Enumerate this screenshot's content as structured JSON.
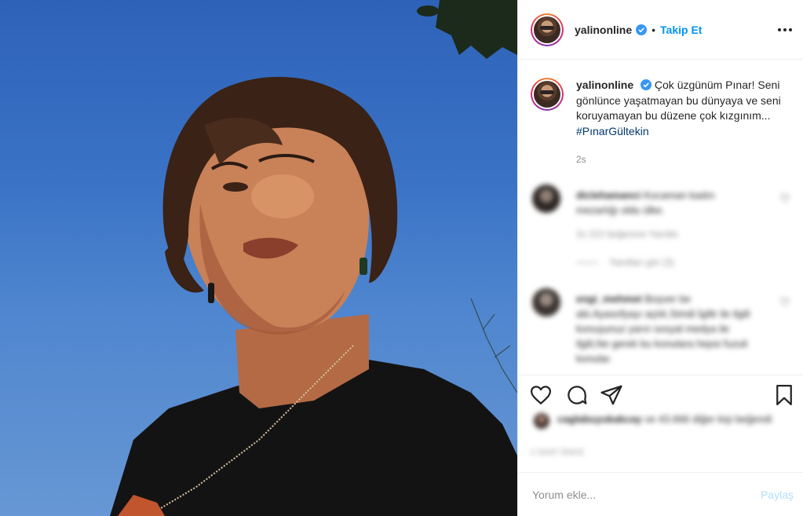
{
  "post": {
    "username": "yalinonline",
    "dot": "•",
    "follow_label": "Takip Et",
    "more_label": "•••"
  },
  "caption": {
    "username": "yalinonline",
    "text": "Çok üzgünüm Pınar! Seni gönlünce yaşatmayan bu dünyaya ve seni koruyamayan bu düzene çok kızgınım...",
    "hashtag": "#PınarGültekin",
    "time": "2s"
  },
  "comments": [
    {
      "username": "diclehamanci",
      "text": "Kocaman kadın mezarlığı oldu ülke.",
      "meta": "2s   222 beğenme   Yanıtla",
      "replies": "Yanıtları gör (3)"
    },
    {
      "username": "engi_mehmet",
      "text": "Boşver be abi.Ayasofyayı açtık.Simdi İgiltr ile ilgili konuşunuz yarın sosyal medya ile ilgili,Ne gerek bu konulara hepsi fuzuli konular."
    }
  ],
  "likes": {
    "user": "caglabuyukakcay",
    "text": "ve 43.666 diğer kişi beğendi"
  },
  "date": "2 SAAT ÖNCE",
  "comment_box": {
    "placeholder": "Yorum ekle...",
    "post_label": "Paylaş"
  },
  "icons": {
    "verified": "verified-badge-icon",
    "like": "heart-icon",
    "comment": "comment-icon",
    "share": "share-icon",
    "save": "bookmark-icon",
    "more": "more-dots-icon"
  },
  "colors": {
    "accent": "#0095f6",
    "hashtag": "#00376b",
    "muted": "#8e8e8e",
    "sky": "#3a73c6"
  }
}
